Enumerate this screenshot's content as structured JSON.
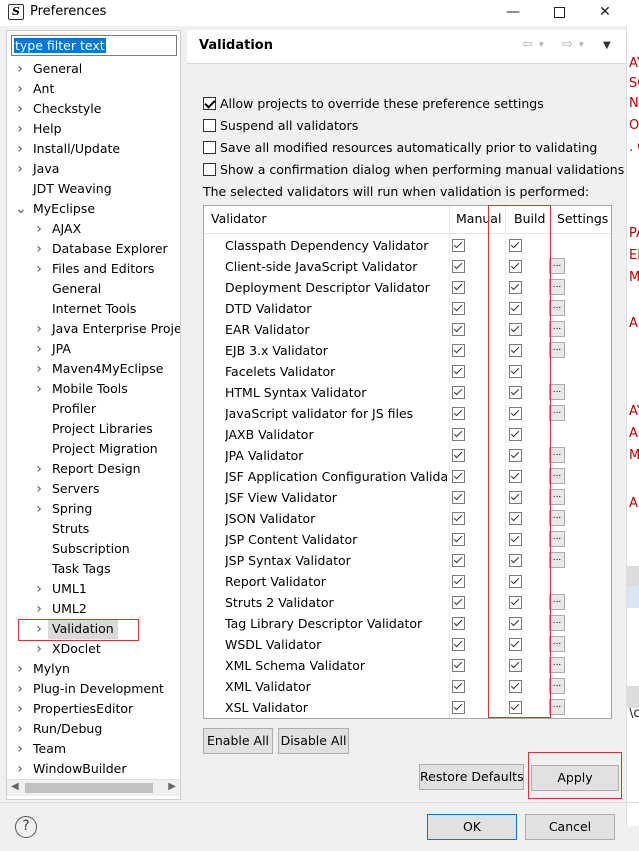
{
  "window": {
    "title": "Preferences",
    "icon_letter": "S",
    "controls": [
      "minimize-icon",
      "maximize-icon",
      "close-icon"
    ]
  },
  "filter": {
    "value": "type filter text"
  },
  "tree": [
    {
      "label": "General",
      "depth": 0,
      "expander": ">"
    },
    {
      "label": "Ant",
      "depth": 0,
      "expander": ">"
    },
    {
      "label": "Checkstyle",
      "depth": 0,
      "expander": ">"
    },
    {
      "label": "Help",
      "depth": 0,
      "expander": ">"
    },
    {
      "label": "Install/Update",
      "depth": 0,
      "expander": ">"
    },
    {
      "label": "Java",
      "depth": 0,
      "expander": ">"
    },
    {
      "label": "JDT Weaving",
      "depth": 0,
      "expander": ""
    },
    {
      "label": "MyEclipse",
      "depth": 0,
      "expander": "v"
    },
    {
      "label": "AJAX",
      "depth": 1,
      "expander": ">"
    },
    {
      "label": "Database Explorer",
      "depth": 1,
      "expander": ">"
    },
    {
      "label": "Files and Editors",
      "depth": 1,
      "expander": ">"
    },
    {
      "label": "General",
      "depth": 1,
      "expander": ""
    },
    {
      "label": "Internet Tools",
      "depth": 1,
      "expander": ""
    },
    {
      "label": "Java Enterprise Proje",
      "depth": 1,
      "expander": ">"
    },
    {
      "label": "JPA",
      "depth": 1,
      "expander": ">"
    },
    {
      "label": "Maven4MyEclipse",
      "depth": 1,
      "expander": ">"
    },
    {
      "label": "Mobile Tools",
      "depth": 1,
      "expander": ">"
    },
    {
      "label": "Profiler",
      "depth": 1,
      "expander": ""
    },
    {
      "label": "Project Libraries",
      "depth": 1,
      "expander": ""
    },
    {
      "label": "Project Migration",
      "depth": 1,
      "expander": ""
    },
    {
      "label": "Report Design",
      "depth": 1,
      "expander": ">"
    },
    {
      "label": "Servers",
      "depth": 1,
      "expander": ">"
    },
    {
      "label": "Spring",
      "depth": 1,
      "expander": ">"
    },
    {
      "label": "Struts",
      "depth": 1,
      "expander": ""
    },
    {
      "label": "Subscription",
      "depth": 1,
      "expander": ""
    },
    {
      "label": "Task Tags",
      "depth": 1,
      "expander": ""
    },
    {
      "label": "UML1",
      "depth": 1,
      "expander": ">"
    },
    {
      "label": "UML2",
      "depth": 1,
      "expander": ">"
    },
    {
      "label": "Validation",
      "depth": 1,
      "expander": ">",
      "selected": true
    },
    {
      "label": "XDoclet",
      "depth": 1,
      "expander": ">"
    },
    {
      "label": "Mylyn",
      "depth": 0,
      "expander": ">"
    },
    {
      "label": "Plug-in Development",
      "depth": 0,
      "expander": ">"
    },
    {
      "label": "PropertiesEditor",
      "depth": 0,
      "expander": ">"
    },
    {
      "label": "Run/Debug",
      "depth": 0,
      "expander": ">"
    },
    {
      "label": "Team",
      "depth": 0,
      "expander": ">"
    },
    {
      "label": "WindowBuilder",
      "depth": 0,
      "expander": ">"
    }
  ],
  "page": {
    "title": "Validation",
    "options": [
      {
        "label": "Allow projects to override these preference settings",
        "checked": true
      },
      {
        "label": "Suspend all validators",
        "checked": false
      },
      {
        "label": "Save all modified resources automatically prior to validating",
        "checked": false
      },
      {
        "label": "Show a confirmation dialog when performing manual validations",
        "checked": false
      }
    ],
    "info": "The selected validators will run when validation is performed:",
    "columns": {
      "validator": "Validator",
      "manual": "Manual",
      "build": "Build",
      "settings": "Settings"
    },
    "validators": [
      {
        "name": "Classpath Dependency Validator",
        "manual": true,
        "build": true,
        "settings": false
      },
      {
        "name": "Client-side JavaScript Validator",
        "manual": true,
        "build": true,
        "settings": true
      },
      {
        "name": "Deployment Descriptor Validator",
        "manual": true,
        "build": true,
        "settings": true
      },
      {
        "name": "DTD Validator",
        "manual": true,
        "build": true,
        "settings": true
      },
      {
        "name": "EAR Validator",
        "manual": true,
        "build": true,
        "settings": true
      },
      {
        "name": "EJB 3.x Validator",
        "manual": true,
        "build": true,
        "settings": true
      },
      {
        "name": "Facelets Validator",
        "manual": true,
        "build": true,
        "settings": false
      },
      {
        "name": "HTML Syntax Validator",
        "manual": true,
        "build": true,
        "settings": true
      },
      {
        "name": "JavaScript validator for JS files",
        "manual": true,
        "build": true,
        "settings": true
      },
      {
        "name": "JAXB Validator",
        "manual": true,
        "build": true,
        "settings": false
      },
      {
        "name": "JPA Validator",
        "manual": true,
        "build": true,
        "settings": true
      },
      {
        "name": "JSF Application Configuration Valida...",
        "manual": true,
        "build": true,
        "settings": true
      },
      {
        "name": "JSF View Validator",
        "manual": true,
        "build": true,
        "settings": true
      },
      {
        "name": "JSON Validator",
        "manual": true,
        "build": true,
        "settings": true
      },
      {
        "name": "JSP Content Validator",
        "manual": true,
        "build": true,
        "settings": true
      },
      {
        "name": "JSP Syntax Validator",
        "manual": true,
        "build": true,
        "settings": true
      },
      {
        "name": "Report Validator",
        "manual": true,
        "build": true,
        "settings": false
      },
      {
        "name": "Struts 2 Validator",
        "manual": true,
        "build": true,
        "settings": true
      },
      {
        "name": "Tag Library Descriptor Validator",
        "manual": true,
        "build": true,
        "settings": true
      },
      {
        "name": "WSDL Validator",
        "manual": true,
        "build": true,
        "settings": true
      },
      {
        "name": "XML Schema Validator",
        "manual": true,
        "build": true,
        "settings": true
      },
      {
        "name": "XML Validator",
        "manual": true,
        "build": true,
        "settings": true
      },
      {
        "name": "XSL Validator",
        "manual": true,
        "build": true,
        "settings": true
      }
    ],
    "settings_button_label": "...",
    "enable_all": "Enable All",
    "disable_all": "Disable All",
    "restore_defaults": "Restore Defaults",
    "apply": "Apply"
  },
  "footer": {
    "help": "?",
    "ok": "OK",
    "cancel": "Cancel"
  },
  "background_app_fragments": [
    "AY",
    "SC",
    "NA",
    "ON",
    ". C",
    "PA",
    "EN",
    "ME",
    "A.",
    "AY",
    "AD",
    "ME",
    "A.",
    "\\c"
  ],
  "colors": {
    "selection_blue": "#0078d7",
    "annotation_red": "#e03030",
    "background_text_red": "#c00000"
  }
}
